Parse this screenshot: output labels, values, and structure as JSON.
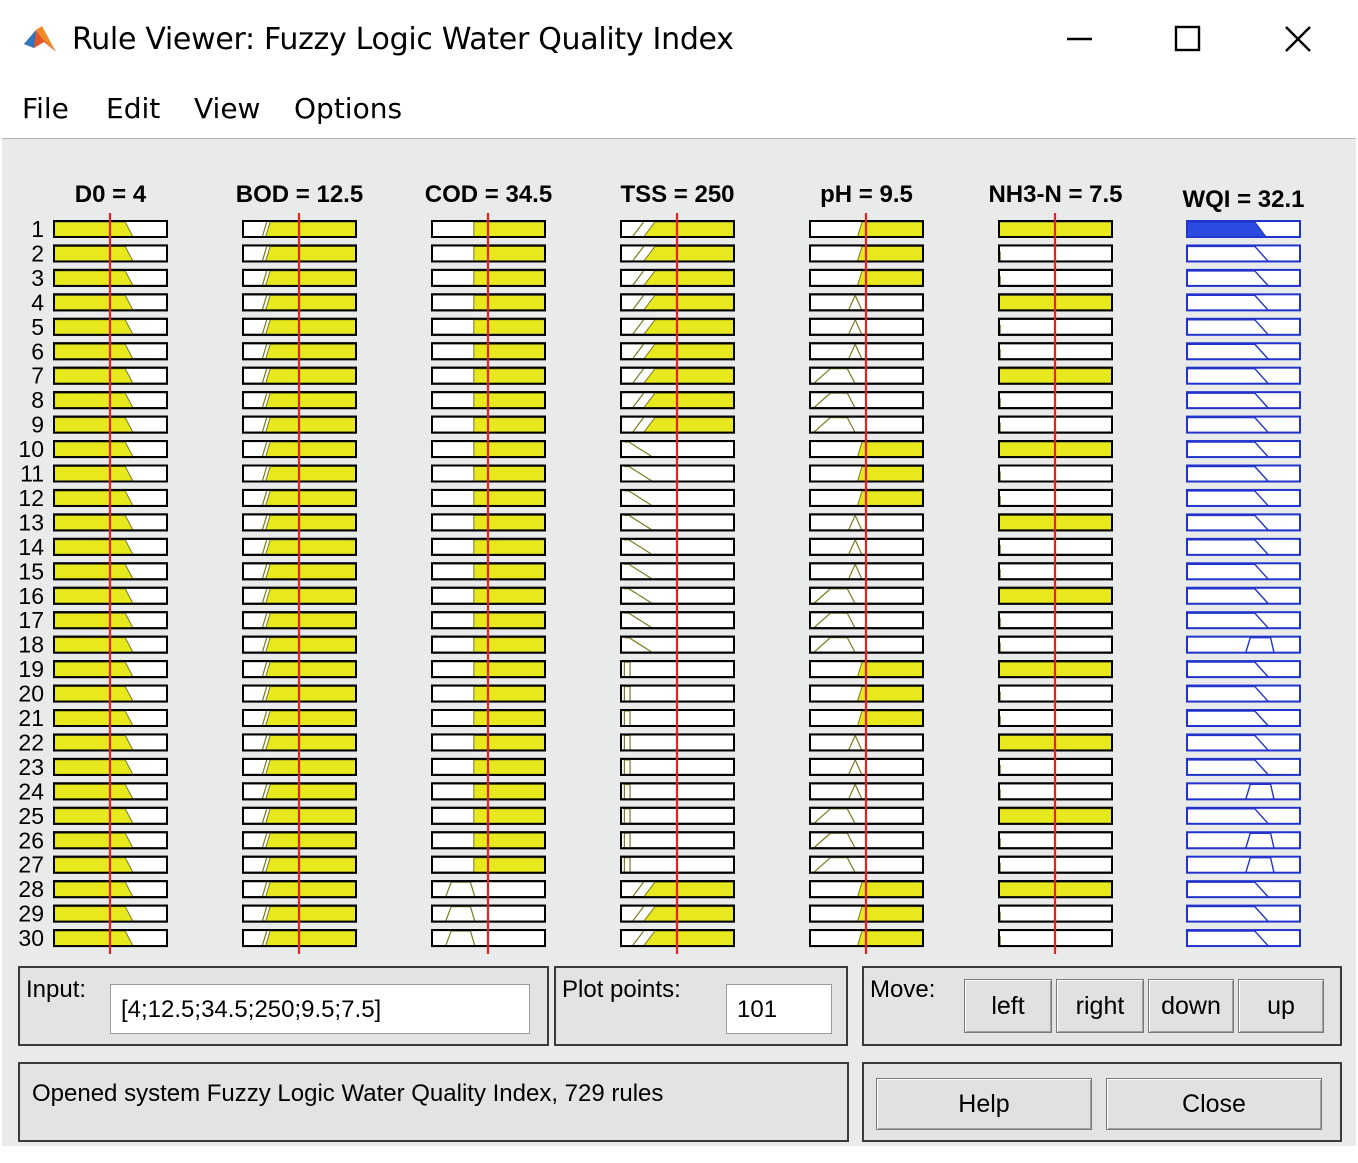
{
  "window": {
    "title": "Rule Viewer: Fuzzy Logic Water Quality Index",
    "icon": "matlab-logo-icon",
    "controls": [
      "minimize-icon",
      "maximize-icon",
      "close-icon"
    ]
  },
  "menu": [
    "File",
    "Edit",
    "View",
    "Options"
  ],
  "variables": [
    {
      "header": "D0 = 4",
      "pattern": "do"
    },
    {
      "header": "BOD = 12.5",
      "pattern": "bod"
    },
    {
      "header": "COD = 34.5",
      "pattern": "cod"
    },
    {
      "header": "TSS = 250",
      "pattern": "tss"
    },
    {
      "header": "pH = 9.5",
      "pattern": "ph"
    },
    {
      "header": "NH3-N = 7.5",
      "pattern": "nh3"
    }
  ],
  "output": {
    "header": "WQI = 32.1"
  },
  "rule_numbers": [
    "1",
    "2",
    "3",
    "4",
    "5",
    "6",
    "7",
    "8",
    "9",
    "10",
    "11",
    "12",
    "13",
    "14",
    "15",
    "16",
    "17",
    "18",
    "19",
    "20",
    "21",
    "22",
    "23",
    "24",
    "25",
    "26",
    "27",
    "28",
    "29",
    "30"
  ],
  "input_panel": {
    "label": "Input:",
    "value": "[4;12.5;34.5;250;9.5;7.5]"
  },
  "plot_points": {
    "label": "Plot points:",
    "value": "101"
  },
  "move": {
    "label": "Move:",
    "buttons": [
      "left",
      "right",
      "down",
      "up"
    ]
  },
  "status": "Opened system Fuzzy Logic Water Quality Index, 729 rules",
  "buttons": {
    "help": "Help",
    "close": "Close"
  },
  "colors": {
    "fill": "#e8e81e",
    "fill_stroke": "#7a7a20",
    "input_line": "#e82020",
    "output_line": "#2233cc",
    "output_fill": "#2a4ae0",
    "background": "#e9eaea"
  }
}
